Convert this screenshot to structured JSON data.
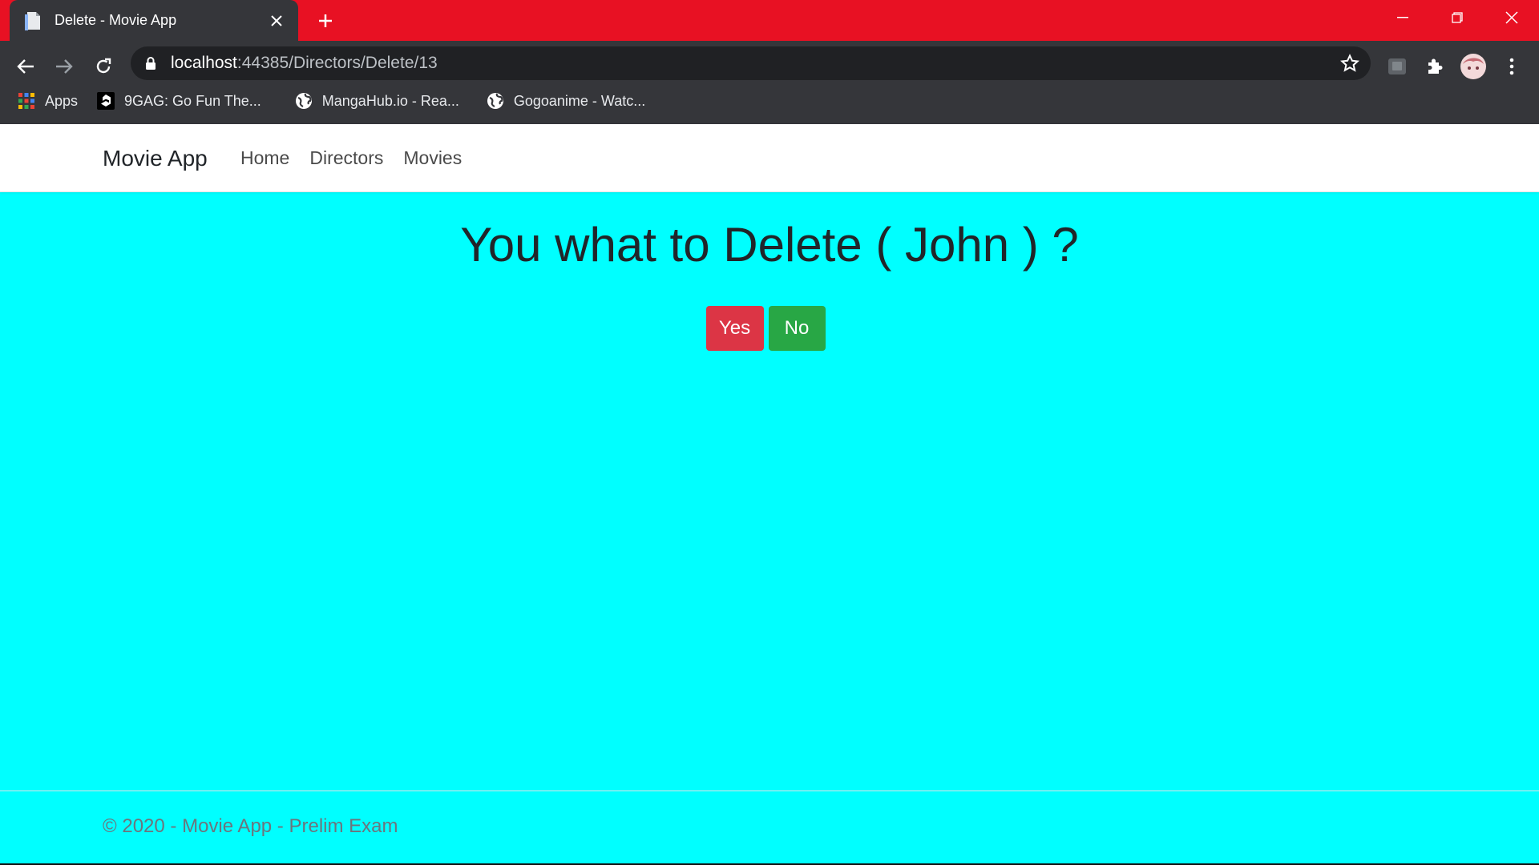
{
  "browser": {
    "tab_title": "Delete - Movie App",
    "url_host": "localhost",
    "url_path": ":44385/Directors/Delete/13",
    "bookmarks": [
      {
        "label": "Apps",
        "icon": "apps-grid-icon"
      },
      {
        "label": "9GAG: Go Fun The...",
        "icon": "9gag-icon"
      },
      {
        "label": "MangaHub.io - Rea...",
        "icon": "globe-icon"
      },
      {
        "label": "Gogoanime - Watc...",
        "icon": "globe-icon"
      }
    ],
    "colors": {
      "titlebar": "#e81123",
      "toolbar": "#35363a",
      "omnibox": "#202124"
    }
  },
  "navbar": {
    "brand": "Movie App",
    "links": [
      "Home",
      "Directors",
      "Movies"
    ]
  },
  "main": {
    "heading": "You what to Delete ( John ) ?",
    "yes_label": "Yes",
    "no_label": "No"
  },
  "footer": {
    "text": "© 2020 - Movie App - Prelim Exam"
  },
  "colors": {
    "page_background": "#00ffff",
    "yes_button": "#dc3545",
    "no_button": "#28a745"
  }
}
